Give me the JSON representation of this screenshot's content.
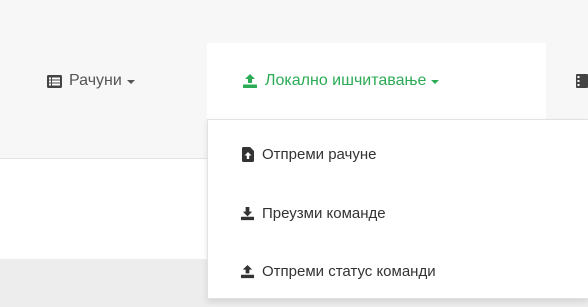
{
  "nav": {
    "accounts": {
      "label": "Рачуни",
      "icon": "list-icon"
    },
    "local_reading": {
      "label": "Локално ишчитавање",
      "icon": "upload-icon"
    },
    "active_color": "#2bab55"
  },
  "dropdown": {
    "items": [
      {
        "label": "Отпреми рачуне",
        "icon": "file-upload-icon"
      },
      {
        "label": "Преузми команде",
        "icon": "download-icon"
      },
      {
        "label": "Отпреми статус команди",
        "icon": "upload-icon"
      }
    ]
  }
}
